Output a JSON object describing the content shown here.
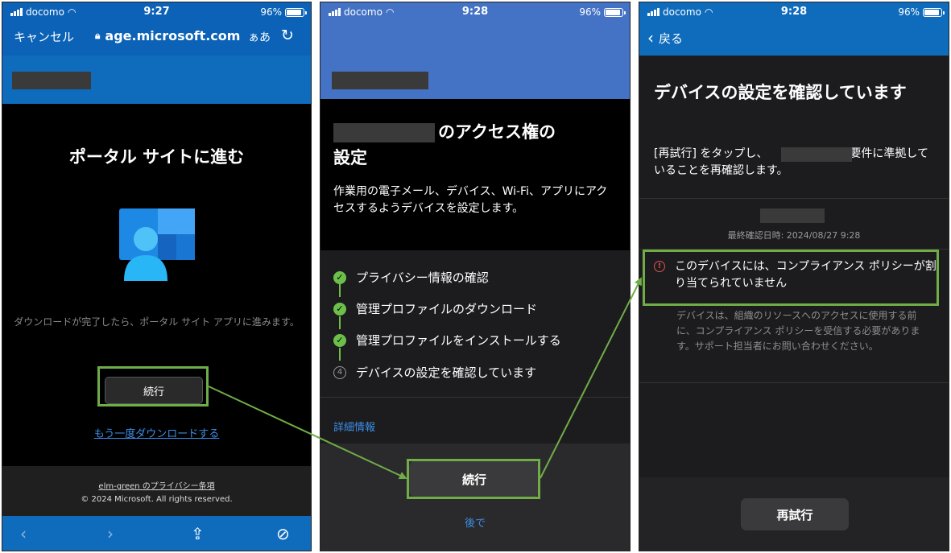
{
  "panel1": {
    "status": {
      "carrier": "docomo",
      "time": "9:27",
      "battery": "96%"
    },
    "browser": {
      "cancel": "キャンセル",
      "url": "age.microsoft.com",
      "text_size": "ぁあ"
    },
    "title": "ポータル サイトに進む",
    "description": "ダウンロードが完了したら、ポータル サイト アプリに進みます。",
    "continue_label": "続行",
    "redownload_label": "もう一度ダウンロードする",
    "footer": {
      "privacy": "elm-green のプライバシー条項",
      "copyright": "© 2024 Microsoft. All rights reserved."
    }
  },
  "panel2": {
    "status": {
      "carrier": "docomo",
      "time": "9:28",
      "battery": "96%"
    },
    "heading_suffix": "のアクセス権の",
    "heading_line2": "設定",
    "intro": "作業用の電子メール、デバイス、Wi-Fi、アプリにアクセスするようデバイスを設定します。",
    "steps": [
      {
        "label": "プライバシー情報の確認",
        "done": true
      },
      {
        "label": "管理プロファイルのダウンロード",
        "done": true
      },
      {
        "label": "管理プロファイルをインストールする",
        "done": true
      },
      {
        "label": "デバイスの設定を確認しています",
        "done": false,
        "number": "4"
      }
    ],
    "more_info": "詳細情報",
    "continue_label": "続行",
    "later_label": "後で"
  },
  "panel3": {
    "status": {
      "carrier": "docomo",
      "time": "9:28",
      "battery": "96%"
    },
    "back_label": "戻る",
    "heading": "デバイスの設定を確認しています",
    "intro_prefix": "[再試行] をタップし、",
    "intro_suffix": "の要件に準拠していることを再確認します。",
    "last_checked": "最終確認日時: 2024/08/27 9:28",
    "alert": "このデバイスには、コンプライアンス ポリシーが割り当てられていません",
    "detail": "デバイスは、組織のリソースへのアクセスに使用する前に、コンプライアンス ポリシーを受信する必要があります。サポート担当者にお問い合わせください。",
    "retry_label": "再試行"
  },
  "colors": {
    "highlight": "#70ad47",
    "link": "#3b8ee8",
    "brand_blue": "#0f6cbd",
    "check_green": "#6cc04a",
    "alert_red": "#e05050"
  }
}
